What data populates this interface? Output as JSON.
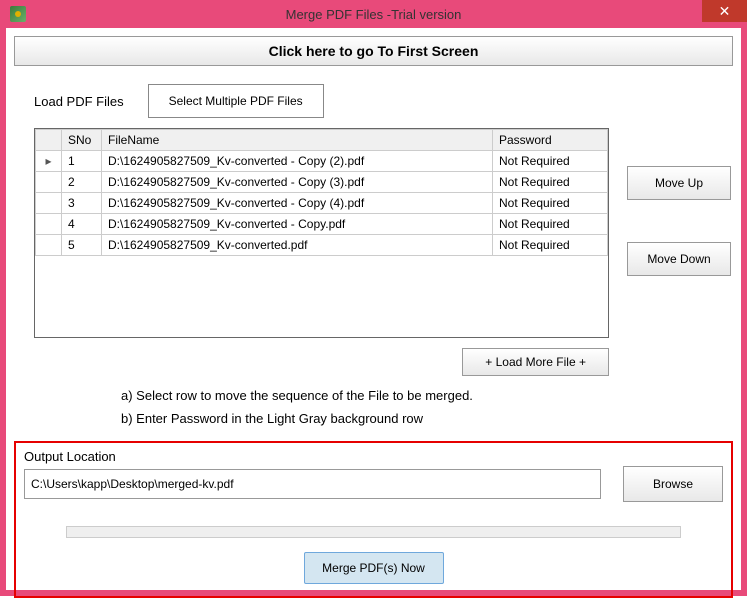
{
  "titlebar": {
    "title": "Merge PDF Files -Trial version",
    "close": "✕"
  },
  "firstScreenBtn": "Click here to go To First Screen",
  "loadLabel": "Load PDF Files",
  "selectBtn": "Select Multiple PDF Files",
  "columns": {
    "sno": "SNo",
    "filename": "FileName",
    "password": "Password"
  },
  "rows": [
    {
      "sno": "1",
      "filename": "D:\\1624905827509_Kv-converted - Copy (2).pdf",
      "password": "Not Required"
    },
    {
      "sno": "2",
      "filename": "D:\\1624905827509_Kv-converted - Copy (3).pdf",
      "password": "Not Required"
    },
    {
      "sno": "3",
      "filename": "D:\\1624905827509_Kv-converted - Copy (4).pdf",
      "password": "Not Required"
    },
    {
      "sno": "4",
      "filename": "D:\\1624905827509_Kv-converted - Copy.pdf",
      "password": "Not Required"
    },
    {
      "sno": "5",
      "filename": "D:\\1624905827509_Kv-converted.pdf",
      "password": "Not Required"
    }
  ],
  "moveUp": "Move Up",
  "moveDown": "Move Down",
  "loadMore": "+ Load More File +",
  "instrA": "a) Select row to move the sequence of the File to be merged.",
  "instrB": "b) Enter Password in the Light Gray background row",
  "outputLabel": "Output Location",
  "outputPath": "C:\\Users\\kapp\\Desktop\\merged-kv.pdf",
  "browse": "Browse",
  "mergeBtn": "Merge  PDF(s) Now"
}
